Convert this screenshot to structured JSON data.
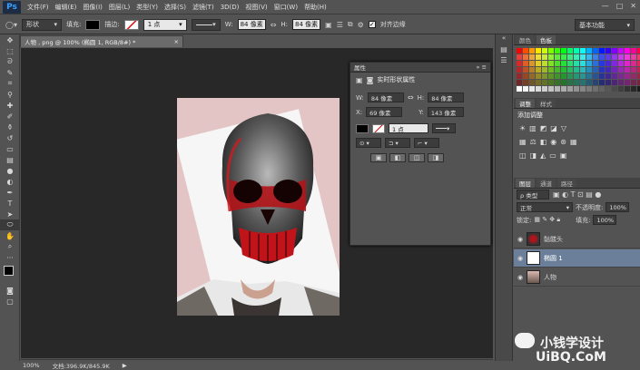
{
  "app": {
    "logo": "Ps"
  },
  "menu": [
    "文件(F)",
    "编辑(E)",
    "图像(I)",
    "图层(L)",
    "类型(Y)",
    "选择(S)",
    "滤镜(T)",
    "3D(D)",
    "视图(V)",
    "窗口(W)",
    "帮助(H)"
  ],
  "window_controls": [
    "—",
    "□",
    "✕"
  ],
  "options": {
    "mode": "形状",
    "fill_label": "填充:",
    "stroke_label": "描边:",
    "stroke_width": "1 点",
    "w_label": "W:",
    "w_value": "84 像素",
    "h_label": "H:",
    "h_value": "84 像素",
    "align_edges": "对齐边缘",
    "workspace": "基本功能"
  },
  "document": {
    "tab": "人物 , png @ 100% (椭圆 1, RGB/8#) *",
    "close": "×"
  },
  "properties": {
    "title": "属性",
    "subtitle": "实时形状属性",
    "w_label": "W:",
    "w_value": "84 像素",
    "h_label": "H:",
    "h_value": "84 像素",
    "x_label": "X:",
    "x_value": "69 像素",
    "y_label": "Y:",
    "y_value": "143 像素",
    "stroke_width": "1 点"
  },
  "swatches_panel": {
    "tabs": [
      "颜色",
      "色板"
    ]
  },
  "adjustments_panel": {
    "tabs": [
      "调整",
      "样式"
    ],
    "heading": "添加调整"
  },
  "layers_panel": {
    "tabs": [
      "图层",
      "通道",
      "路径"
    ],
    "filter": "ρ 类型",
    "blend_mode": "正常",
    "opacity_label": "不透明度:",
    "opacity": "100%",
    "lock_label": "锁定:",
    "fill_label": "填充:",
    "fill": "100%",
    "layers": [
      {
        "name": "骷髅头",
        "visible": true,
        "selected": false
      },
      {
        "name": "椭圆 1",
        "visible": true,
        "selected": true
      },
      {
        "name": "人物",
        "visible": true,
        "selected": false
      }
    ]
  },
  "status": {
    "zoom": "100%",
    "doc": "文档:396.9K/845.9K",
    "arrow": "▶"
  },
  "watermark": {
    "line1": "小钱学设计",
    "line2": "UiBQ.CoM"
  },
  "colors": {
    "ui_bg": "#535353",
    "canvas_bg": "#282828",
    "artboard": "#e3c5c6",
    "selected_layer": "#6b7f9a",
    "skull_red": "#c0141a"
  },
  "icons": [
    "move-tool-icon",
    "marquee-tool-icon",
    "lasso-tool-icon",
    "quick-select-icon",
    "crop-tool-icon",
    "eyedropper-icon",
    "healing-brush-icon",
    "brush-tool-icon",
    "clone-stamp-icon",
    "history-brush-icon",
    "eraser-icon",
    "gradient-icon",
    "blur-icon",
    "dodge-icon",
    "pen-tool-icon",
    "type-tool-icon",
    "path-select-icon",
    "ellipse-tool-icon",
    "hand-tool-icon",
    "zoom-tool-icon",
    "gear-icon",
    "link-icon",
    "eye-icon"
  ]
}
